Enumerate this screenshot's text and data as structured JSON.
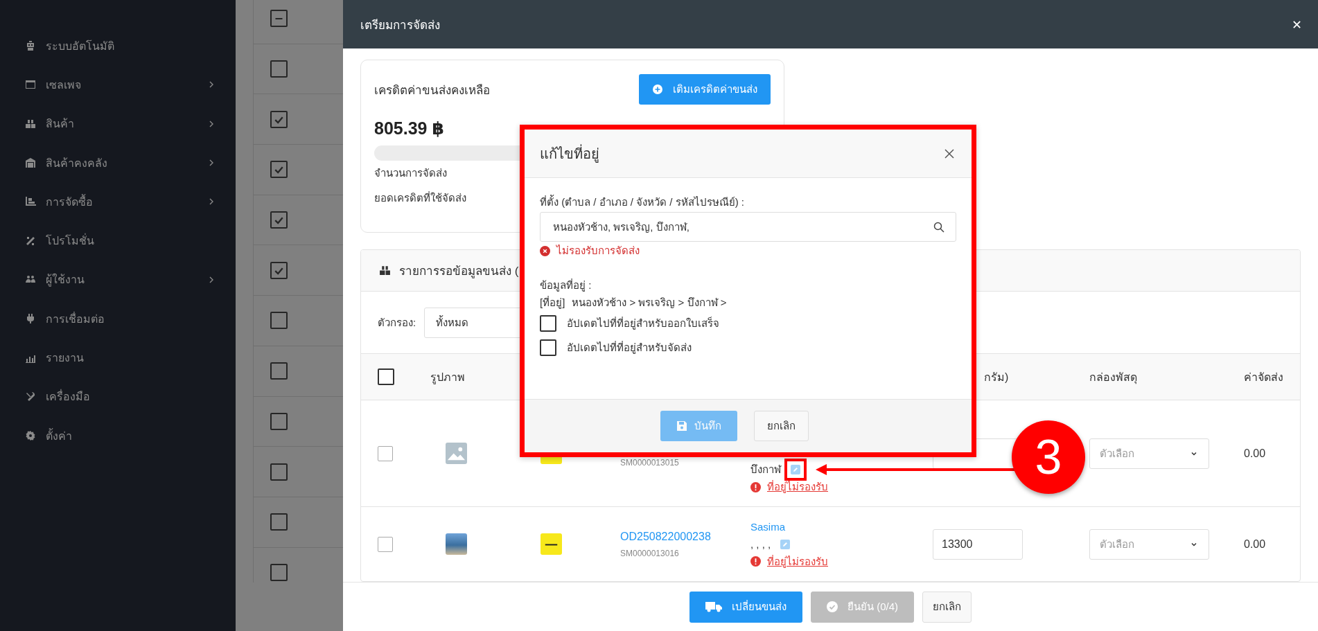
{
  "sidebar": {
    "items": [
      {
        "label": "ระบบอัตโนมัติ",
        "kind": "robot",
        "has_submenu": false
      },
      {
        "label": "เซลเพจ",
        "kind": "window",
        "has_submenu": true
      },
      {
        "label": "สินค้า",
        "kind": "boxes",
        "has_submenu": true
      },
      {
        "label": "สินค้าคงคลัง",
        "kind": "warehouse",
        "has_submenu": true
      },
      {
        "label": "การจัดซื้อ",
        "kind": "dolly",
        "has_submenu": true
      },
      {
        "label": "โปรโมชั่น",
        "kind": "percent",
        "has_submenu": false
      },
      {
        "label": "ผู้ใช้งาน",
        "kind": "users",
        "has_submenu": true
      },
      {
        "label": "การเชื่อมต่อ",
        "kind": "plug",
        "has_submenu": false
      },
      {
        "label": "รายงาน",
        "kind": "chart",
        "has_submenu": false
      },
      {
        "label": "เครื่องมือ",
        "kind": "tools",
        "has_submenu": false
      },
      {
        "label": "ตั้งค่า",
        "kind": "gear",
        "has_submenu": false
      }
    ]
  },
  "background_table": {
    "select_all_partial": true,
    "rows": [
      {
        "checked": false
      },
      {
        "checked": true
      },
      {
        "checked": true
      },
      {
        "checked": true
      },
      {
        "checked": true
      },
      {
        "checked": false
      },
      {
        "checked": false
      },
      {
        "checked": false
      },
      {
        "checked": false
      },
      {
        "checked": false
      },
      {
        "checked": false
      }
    ]
  },
  "drawer": {
    "title": "เตรียมการจัดส่ง",
    "credit": {
      "title": "เครดิตค่าขนส่งคงเหลือ",
      "topup_button": "เติมเครดิตค่าขนส่ง",
      "balance": "805.39 ฿",
      "level": 0,
      "labels": [
        "จำนวนการจัดส่ง",
        "ยอดเครดิตที่ใช้จัดส่ง"
      ]
    },
    "panel": {
      "title": "รายการรอข้อมูลขนส่ง (",
      "filter_label": "ตัวกรอง:",
      "filter_value": "ทั้งหมด",
      "select_all_checked": false,
      "columns": {
        "image": "รูปภาพ",
        "weight": "กรัม)",
        "box": "กล่องพัสดุ",
        "fee": "ค่าจัดส่ง"
      },
      "rows": [
        {
          "checked": false,
          "kind": "placeholder",
          "shipment_no": "SM0000013015",
          "address": "บึงกาฬ",
          "address_warning": "ที่อยู่ไม่รองรับ",
          "box_placeholder": "ตัวเลือก",
          "fee": "0.00"
        },
        {
          "checked": false,
          "kind": "photo",
          "order_no": "OD250822000238",
          "shipment_no": "SM0000013016",
          "customer": "Sasima",
          "address": ", , , ,",
          "address_warning": "ที่อยู่ไม่รองรับ",
          "weight": "13300",
          "box_placeholder": "ตัวเลือก",
          "fee": "0.00"
        }
      ]
    },
    "footer_buttons": [
      {
        "label": "เปลี่ยนขนส่ง",
        "kind": "primary",
        "disabled": false
      },
      {
        "label": "ยืนยัน (0/4)",
        "kind": "confirm",
        "disabled": true
      },
      {
        "label": "ยกเลิก",
        "kind": "plain",
        "disabled": false
      }
    ]
  },
  "modal": {
    "title": "แก้ไขที่อยู่",
    "location_label": "ที่ตั้ง (ตำบล / อำเภอ / จังหวัด / รหัสไปรษณีย์) :",
    "location_value": "หนองหัวช้าง, พรเจริญ, บึงกาฬ,",
    "error": "ไม่รองรับการจัดส่ง",
    "info_label": "ข้อมูลที่อยู่ :",
    "info_tag": "[ที่อยู่]",
    "info_path": "หนองหัวช้าง > พรเจริญ > บึงกาฬ >",
    "options": [
      {
        "label": "อัปเดตไปที่ที่อยู่สำหรับออกใบเสร็จ",
        "checked": false
      },
      {
        "label": "อัปเดตไปที่ที่อยู่สำหรับจัดส่ง",
        "checked": false
      }
    ],
    "buttons": [
      {
        "label": "บันทึก",
        "kind": "save",
        "disabled": true
      },
      {
        "label": "ยกเลิก",
        "kind": "plain",
        "disabled": false
      }
    ]
  },
  "annotation": {
    "number": "3"
  }
}
